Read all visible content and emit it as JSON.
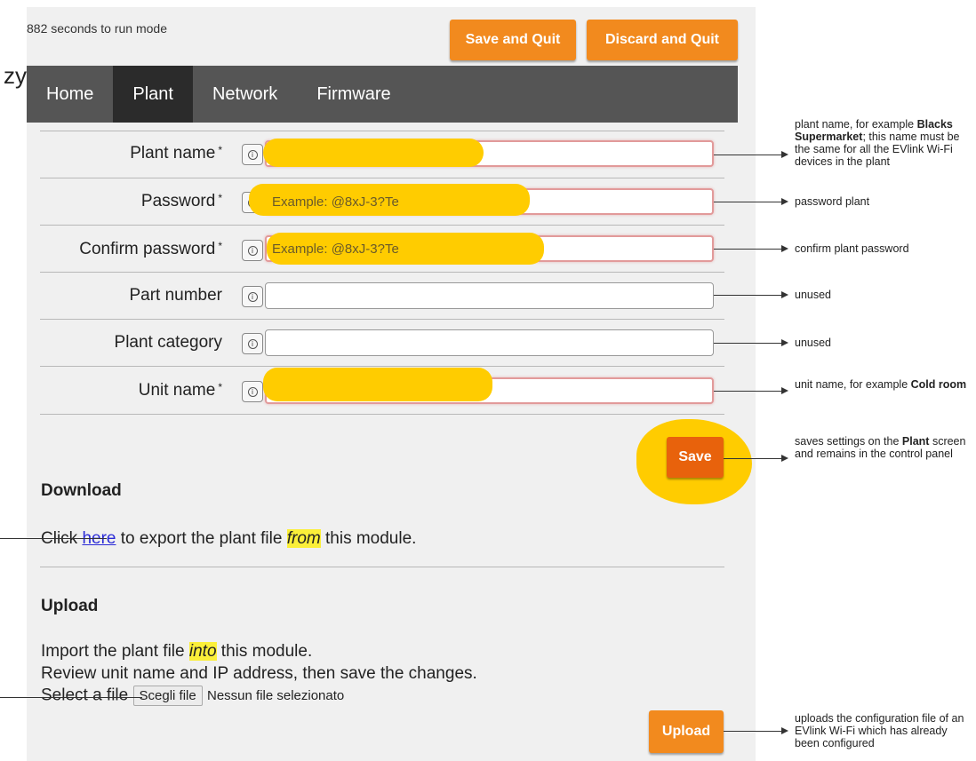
{
  "header": {
    "countdown": "882 seconds to run mode",
    "save_quit_label": "Save and Quit",
    "discard_quit_label": "Discard and Quit",
    "stray_text": "zy"
  },
  "nav": {
    "tabs": [
      {
        "label": "Home",
        "active": false
      },
      {
        "label": "Plant",
        "active": true
      },
      {
        "label": "Network",
        "active": false
      },
      {
        "label": "Firmware",
        "active": false
      }
    ]
  },
  "form": {
    "fields": [
      {
        "label": "Plant name",
        "required": true,
        "value": "",
        "placeholder": ""
      },
      {
        "label": "Password",
        "required": true,
        "value": "",
        "placeholder": "Example:  @8xJ-3?Te"
      },
      {
        "label": "Confirm password",
        "required": true,
        "value": "",
        "placeholder": "Example:  @8xJ-3?Te"
      },
      {
        "label": "Part number",
        "required": false,
        "value": "",
        "placeholder": ""
      },
      {
        "label": "Plant category",
        "required": false,
        "value": "",
        "placeholder": ""
      },
      {
        "label": "Unit name",
        "required": true,
        "value": "",
        "placeholder": ""
      }
    ],
    "required_mark": "*",
    "save_label": "Save"
  },
  "download": {
    "heading": "Download",
    "text_prefix": "Click ",
    "link": "here",
    "text_middle": " to export the plant file ",
    "highlight": "from",
    "text_suffix": " this module."
  },
  "upload": {
    "heading": "Upload",
    "line1_prefix": "Import the plant file ",
    "line1_highlight": "into",
    "line1_suffix": " this module.",
    "line2": "Review  unit  name and IP address, then save the changes.",
    "select_label": "Select a file",
    "file_button": "Scegli file",
    "file_status": "Nessun file selezionato",
    "upload_label": "Upload"
  },
  "callouts": {
    "plant_name": {
      "pre": "plant name, for example ",
      "bold": "Blacks Supermarket",
      "post": "; this name must be the same for all the EVlink Wi-Fi devices in the plant"
    },
    "password": "password plant",
    "confirm_password": "confirm plant password",
    "part_number": "unused",
    "plant_category": "unused",
    "unit_name": {
      "pre": "unit name, for example ",
      "bold": "Cold room"
    },
    "save": {
      "pre": "saves settings on the ",
      "bold": "Plant",
      "post": " screen and remains in the control panel"
    },
    "upload": "uploads the configuration file of an EVlink Wi-Fi which has already been configured"
  },
  "colors": {
    "accent": "#f28a1e",
    "highlight_marker": "#ffcc00",
    "nav_bg": "#555555",
    "nav_active": "#2b2b2b"
  }
}
